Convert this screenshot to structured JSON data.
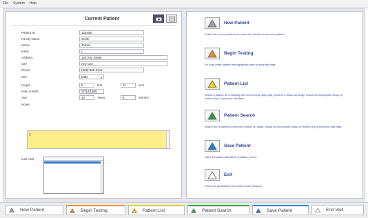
{
  "menu": [
    "File",
    "System",
    "Help"
  ],
  "patient": {
    "title": "Current Patient",
    "fields": [
      {
        "label": "Patient ID",
        "value": "123456"
      },
      {
        "label": "Family Name",
        "value": "Smith"
      },
      {
        "label": "Name",
        "value": "James"
      },
      {
        "label": "Initial",
        "value": "L"
      },
      {
        "label": "Address",
        "value": "123 Any Street"
      },
      {
        "label": "City",
        "value": "Any City"
      },
      {
        "label": "Phone",
        "value": "(608) 555-5212"
      }
    ],
    "sex": {
      "label": "Sex",
      "value": "Male"
    },
    "height": {
      "label": "Height",
      "feet": "5",
      "feet_unit": "feet",
      "inches": "11",
      "inch_unit": "inch"
    },
    "dob": {
      "label": "Date of Birth",
      "value": "07/14/1969"
    },
    "age": {
      "label": "Age",
      "years": "32",
      "years_unit": "Years",
      "months": "8",
      "months_unit": "Months"
    },
    "notes_label": "Notes",
    "last_visit_label": "Last Visit"
  },
  "actions": [
    {
      "title": "New Patient",
      "desc": "Finish the current patient and enter the details for the next patient.",
      "color": "#9aa0a6"
    },
    {
      "title": "Begin Testing",
      "desc": "You can enter patient demographics later to save the data.",
      "color": "#f08a24"
    },
    {
      "title": "Patient List",
      "desc": "Select a patient for reviewing the most recent (last) visit, perform a follow up study, restart an incomplete study, or review any of previous visit data.",
      "color": "#f2cc1e"
    },
    {
      "title": "Patient Search",
      "desc": "Search for a patient to perform a follow up study, restart an incomplete study, or review any of previous visit data.",
      "color": "#2e9a3c"
    },
    {
      "title": "Save Patient",
      "desc": "Save the patient details to a patient record.",
      "color": "#1e7dc8"
    },
    {
      "title": "Exit",
      "desc": "Close the application and return to the desktop.",
      "color": "#ffffff"
    }
  ],
  "tabs": [
    {
      "label": "New Patient",
      "color": "#9aa0a6"
    },
    {
      "label": "Begin Testing",
      "color": "#f08a24"
    },
    {
      "label": "Patient List",
      "color": "#f2cc1e"
    },
    {
      "label": "Patient Search",
      "color": "#2e9a3c"
    },
    {
      "label": "Save Patient",
      "color": "#1e7dc8"
    },
    {
      "label": "End Visit",
      "color": "#ffffff"
    }
  ]
}
